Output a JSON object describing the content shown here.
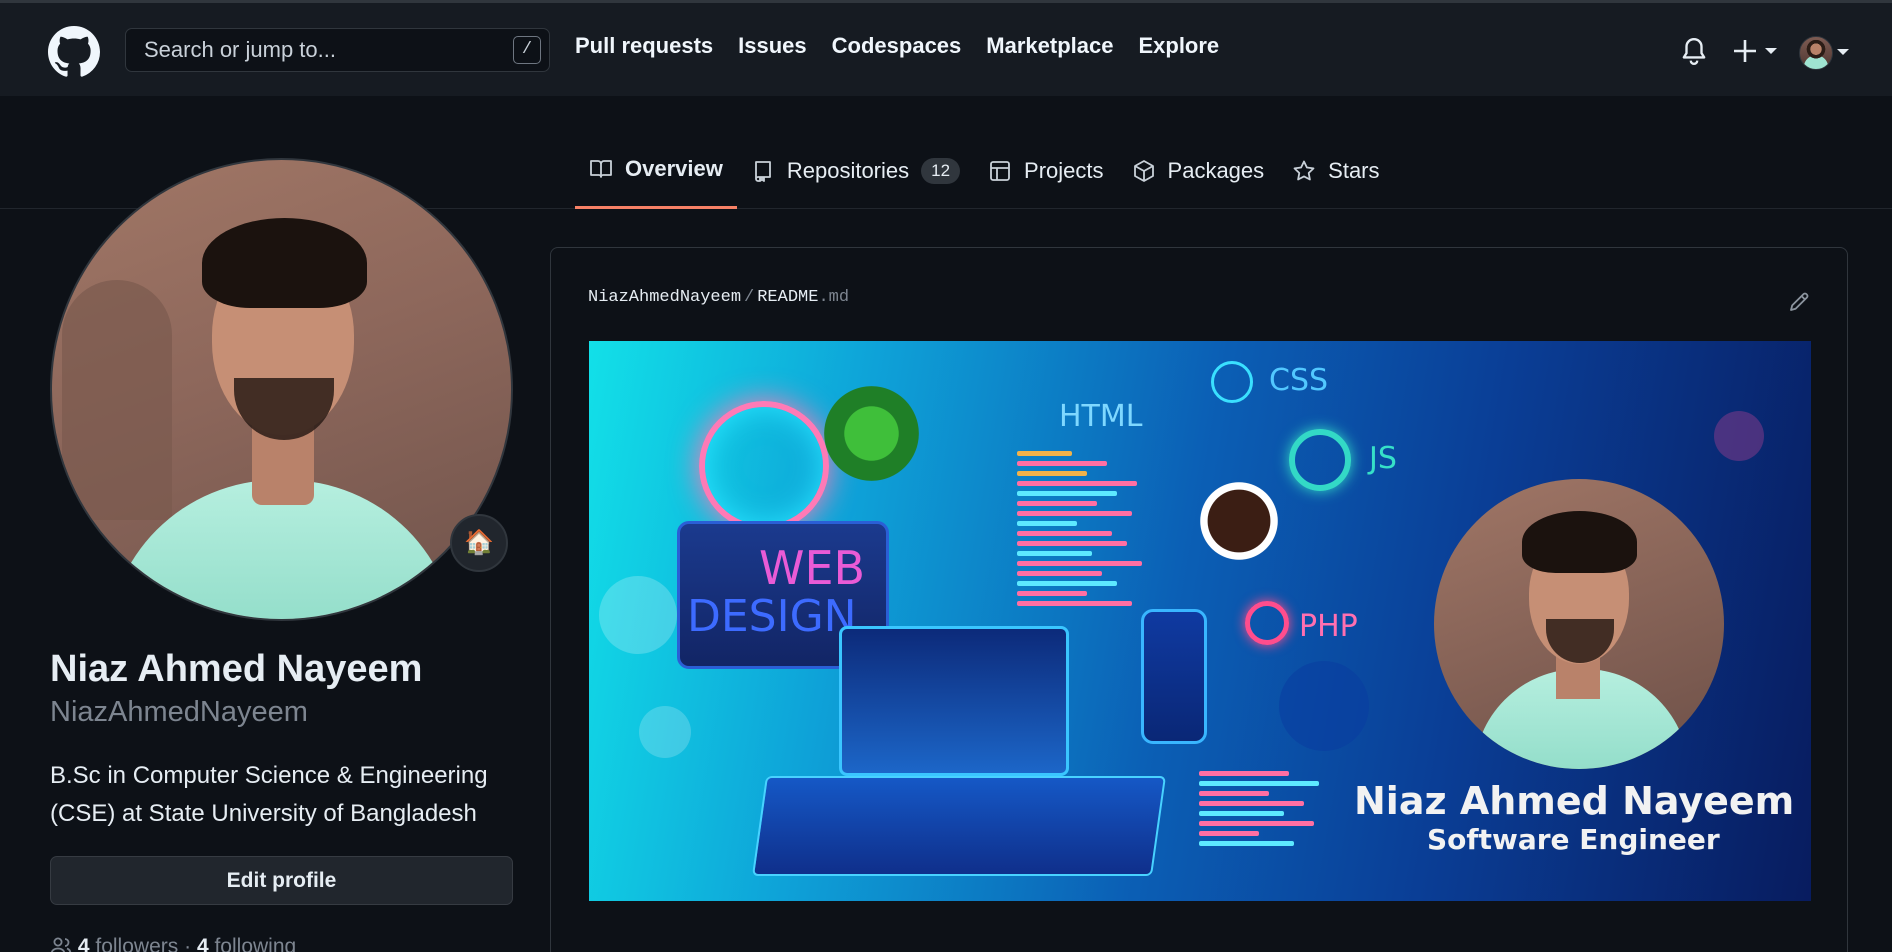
{
  "header": {
    "search_placeholder": "Search or jump to...",
    "search_shortcut": "/",
    "nav": [
      "Pull requests",
      "Issues",
      "Codespaces",
      "Marketplace",
      "Explore"
    ],
    "icons": [
      "github-logo-icon",
      "bell-icon",
      "plus-icon",
      "avatar"
    ]
  },
  "tabs": [
    {
      "label": "Overview",
      "icon": "book-icon",
      "active": true
    },
    {
      "label": "Repositories",
      "icon": "repo-icon",
      "count": "12"
    },
    {
      "label": "Projects",
      "icon": "table-icon"
    },
    {
      "label": "Packages",
      "icon": "package-icon"
    },
    {
      "label": "Stars",
      "icon": "star-icon"
    }
  ],
  "profile": {
    "status_emoji": "🏠",
    "name": "Niaz Ahmed Nayeem",
    "username": "NiazAhmedNayeem",
    "bio": "B.Sc in Computer Science & Engineering (CSE) at State University of Bangladesh",
    "edit_button": "Edit profile",
    "followers_count": "4",
    "followers_label": "followers",
    "following_count": "4",
    "following_label": "following",
    "separator": "·"
  },
  "readme": {
    "owner": "NiazAhmedNayeem",
    "separator": "/",
    "file_base": "README",
    "file_ext": ".md",
    "banner": {
      "web": "WEB",
      "design": "DESIGN",
      "html": "HTML",
      "css": "CSS",
      "js": "JS",
      "php": "PHP",
      "name": "Niaz Ahmed Nayeem",
      "title": "Software Engineer"
    }
  },
  "colors": {
    "background": "#0d1117",
    "header": "#161b22",
    "active_tab_underline": "#f78166",
    "muted_text": "#7d8590"
  }
}
